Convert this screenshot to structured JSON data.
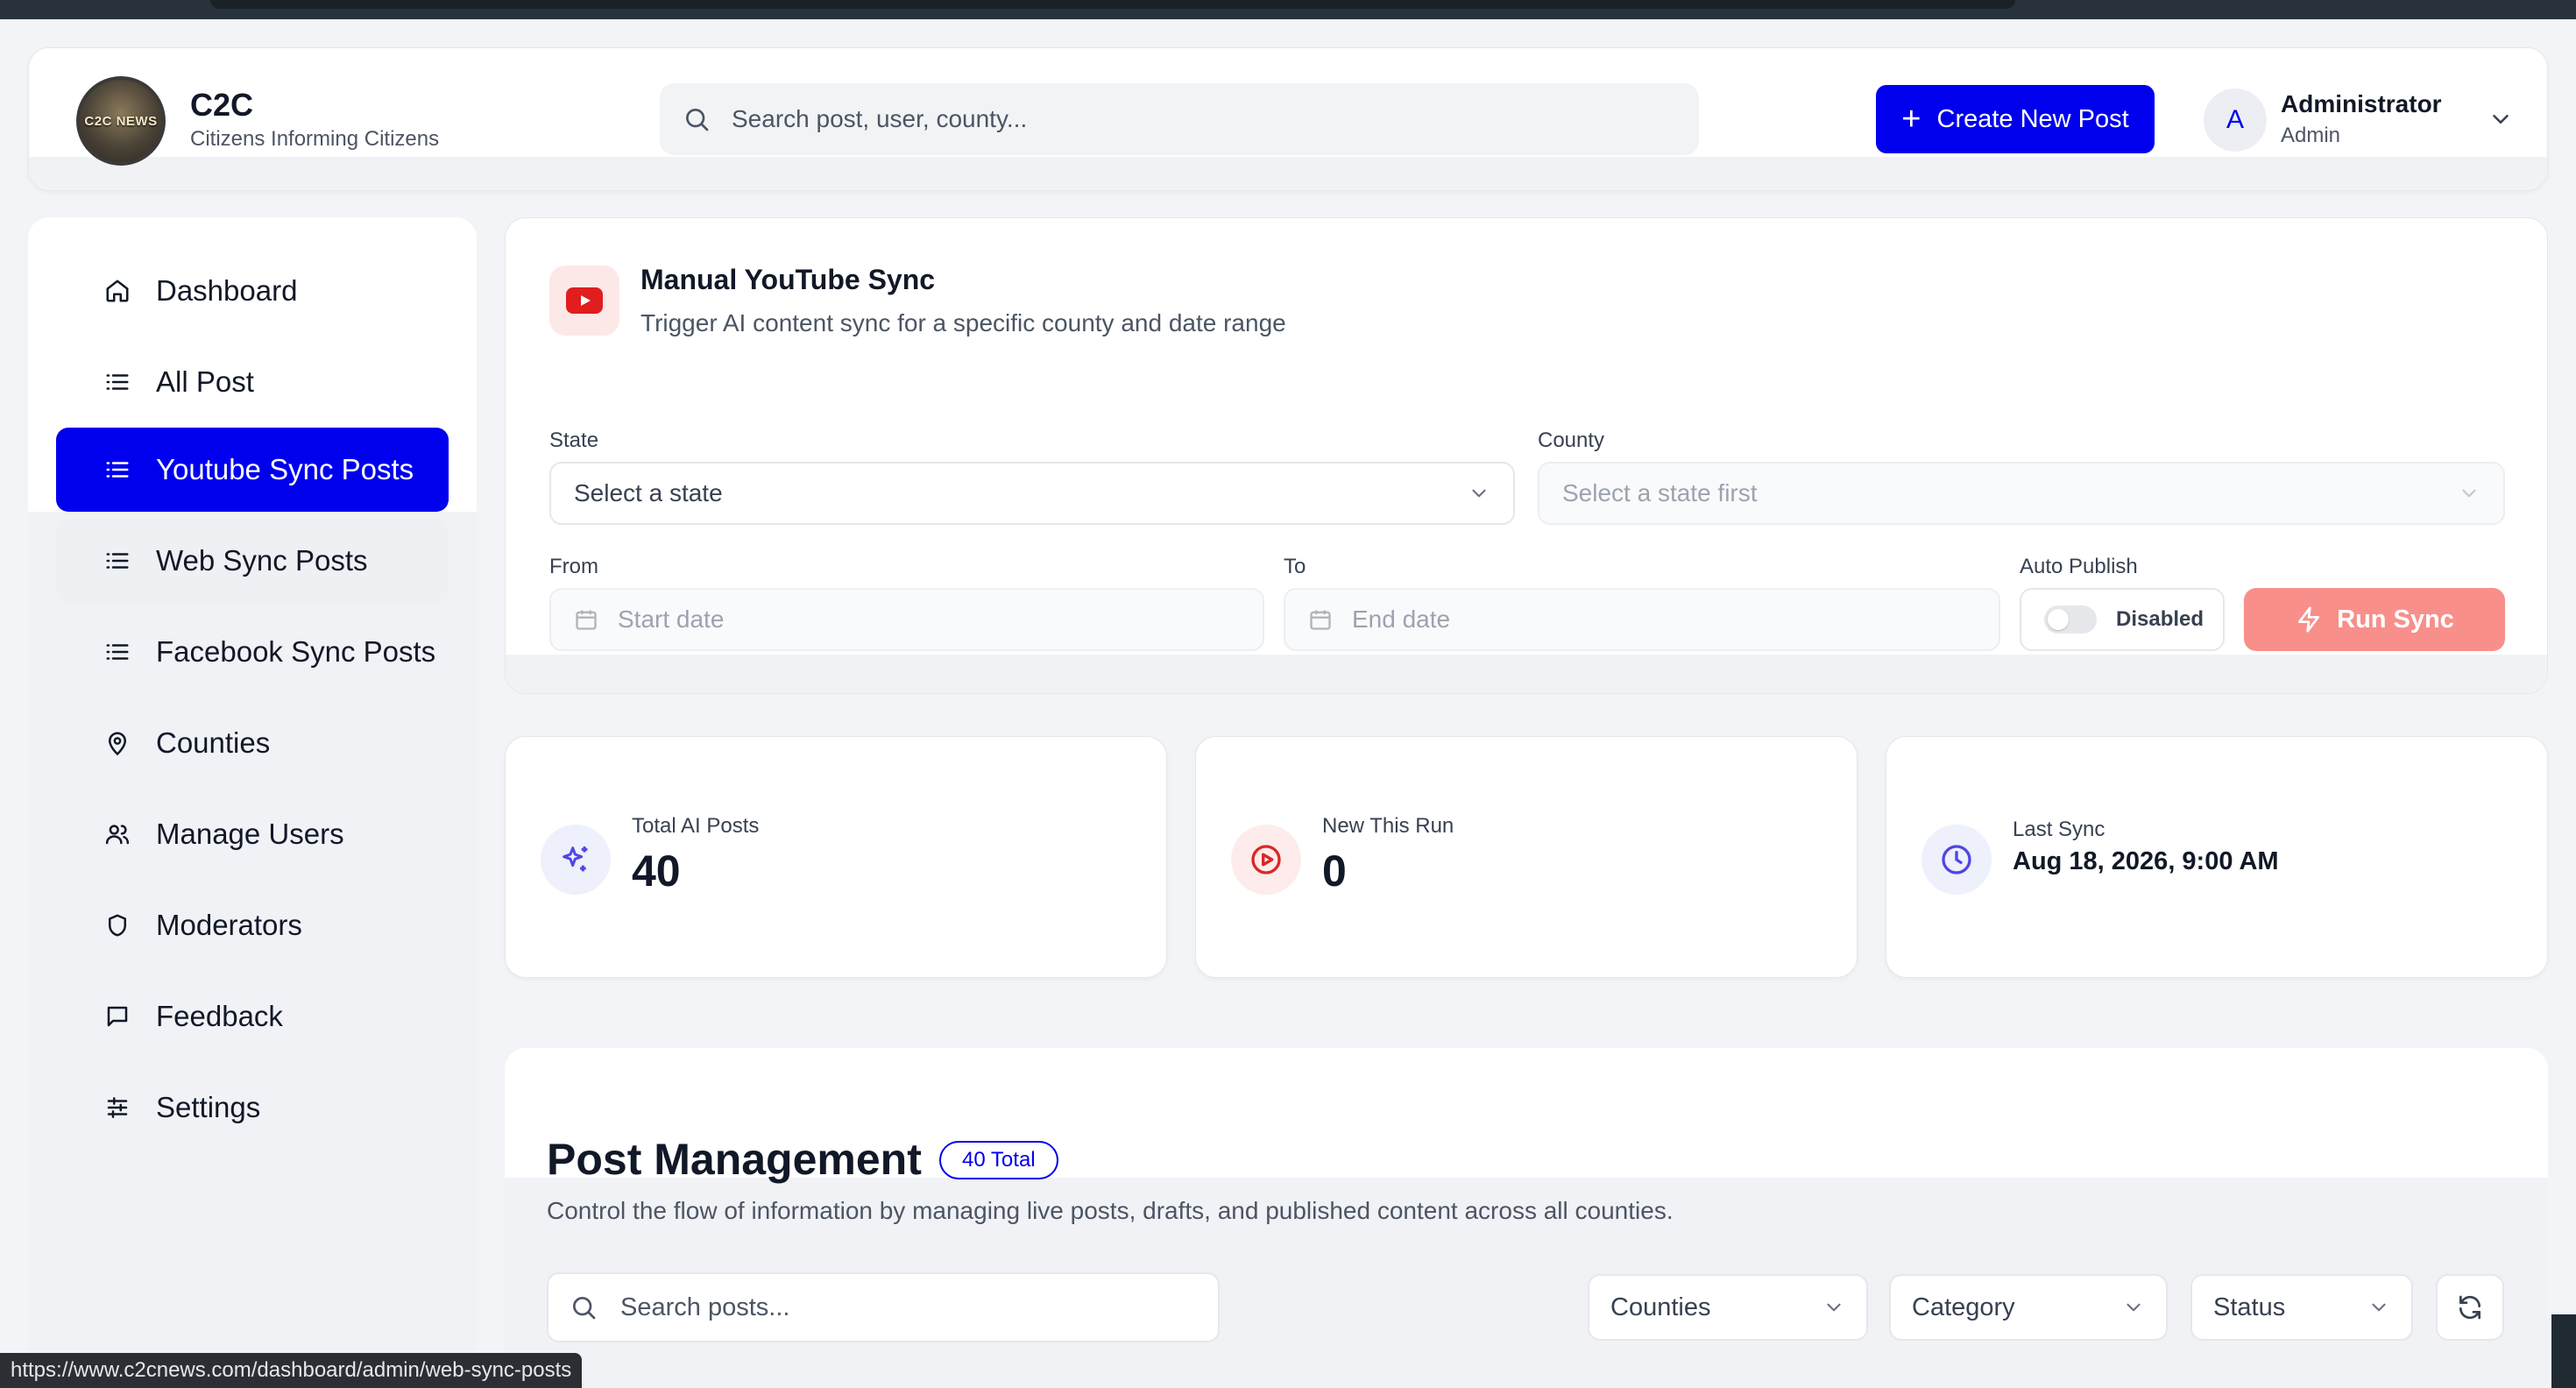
{
  "brand": {
    "logo_text": "C2C NEWS",
    "title": "C2C",
    "subtitle": "Citizens Informing Citizens"
  },
  "header": {
    "search_placeholder": "Search post, user, county...",
    "create_button": "Create New Post",
    "user": {
      "avatar_letter": "A",
      "name": "Administrator",
      "role": "Admin"
    }
  },
  "sidebar": {
    "items": [
      {
        "label": "Dashboard",
        "icon": "home-icon"
      },
      {
        "label": "All Post",
        "icon": "list-icon"
      },
      {
        "label": "Youtube Sync Posts",
        "icon": "list-icon",
        "active": true
      },
      {
        "label": "Web Sync Posts",
        "icon": "list-icon"
      },
      {
        "label": "Facebook Sync Posts",
        "icon": "list-icon"
      },
      {
        "label": "Counties",
        "icon": "map-pin-icon"
      },
      {
        "label": "Manage Users",
        "icon": "users-icon"
      },
      {
        "label": "Moderators",
        "icon": "shield-icon"
      },
      {
        "label": "Feedback",
        "icon": "message-square-icon"
      },
      {
        "label": "Settings",
        "icon": "sliders-icon"
      }
    ]
  },
  "sync": {
    "title": "Manual YouTube Sync",
    "subtitle": "Trigger AI content sync for a specific county and date range",
    "state_label": "State",
    "state_value": "Select a state",
    "county_label": "County",
    "county_value": "Select a state first",
    "from_label": "From",
    "from_placeholder": "Start date",
    "to_label": "To",
    "to_placeholder": "End date",
    "auto_publish_label": "Auto Publish",
    "auto_publish_state": "Disabled",
    "run_button": "Run Sync"
  },
  "stats": [
    {
      "label": "Total AI Posts",
      "value": "40",
      "icon": "sparkles-icon"
    },
    {
      "label": "New This Run",
      "value": "0",
      "icon": "play-circle-icon"
    },
    {
      "label": "Last Sync",
      "value": "Aug 18, 2026, 9:00 AM",
      "icon": "clock-icon"
    }
  ],
  "post_management": {
    "title": "Post Management",
    "badge": "40 Total",
    "subtitle": "Control the flow of information by managing live posts, drafts, and published content across all counties.",
    "search_placeholder": "Search posts...",
    "filters": [
      "Counties",
      "Category",
      "Status"
    ]
  },
  "status_url": "https://www.c2cnews.com/dashboard/admin/web-sync-posts",
  "colors": {
    "accent": "#0000ee",
    "run_button": "#f88f8a",
    "youtube_red": "#e11d1d",
    "stat_icon_purple": "#4f46e5",
    "stat_icon_red": "#dc2626"
  }
}
